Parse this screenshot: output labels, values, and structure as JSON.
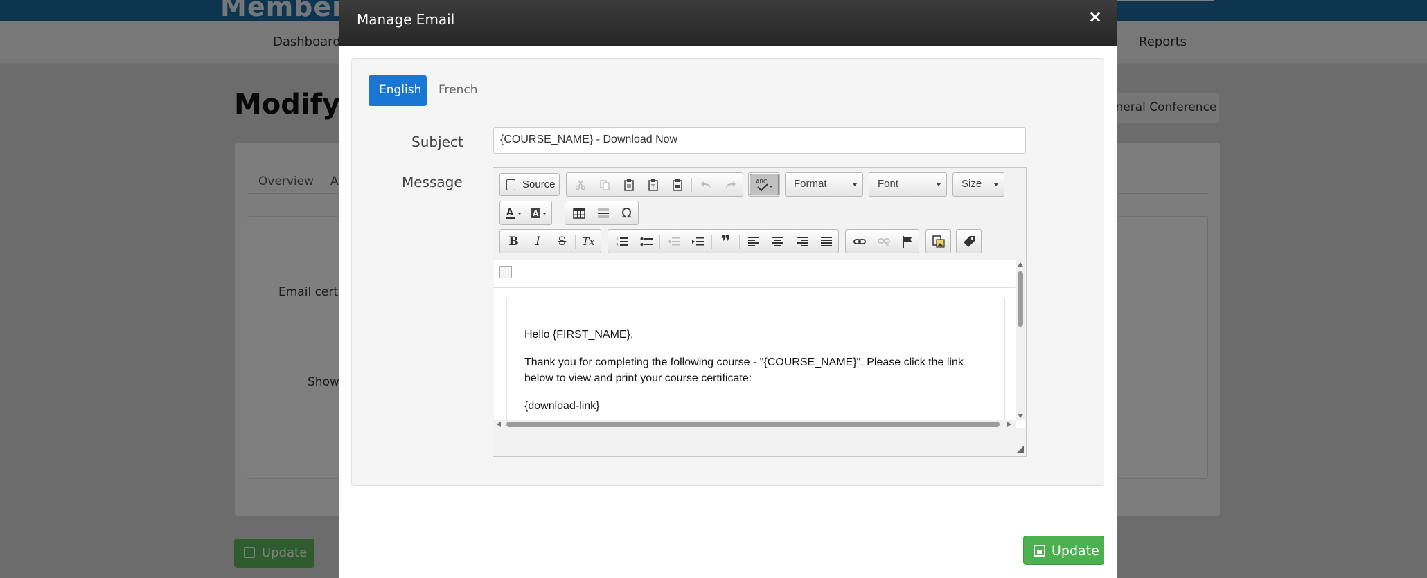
{
  "background": {
    "logo": "Member",
    "nav": [
      "Dashboard",
      "Reports"
    ],
    "page_title": "Modify L",
    "breadcrumb_button": "eneral Conference",
    "tabs": [
      "Overview",
      "A"
    ],
    "labels": [
      "Email certif",
      "Show"
    ],
    "update_label": "Update"
  },
  "modal": {
    "title": "Manage Email",
    "close_symbol": "×",
    "tabs": {
      "english": "English",
      "french": "French"
    },
    "subject_label": "Subject",
    "subject_value": "{COURSE_NAME} - Download Now",
    "message_label": "Message",
    "toolbar": {
      "source_label": "Source",
      "format_label": "Format",
      "font_label": "Font",
      "size_label": "Size",
      "omega_glyph": "Ω",
      "bold_glyph": "B",
      "italic_glyph": "I",
      "strike_glyph": "S",
      "clear_format_glyph": "Tx",
      "blockquote_glyph": "❞"
    },
    "email_body": {
      "greeting": "Hello {FIRST_NAME},",
      "line1": "Thank you for completing the following course - \"{COURSE_NAME}\". Please click the link",
      "line2": "below to view and print your course certificate:",
      "link_placeholder": "{download-link}"
    },
    "update_label": "Update"
  },
  "colors": {
    "primary_blue": "#1976d2",
    "success_green": "#4caf50",
    "header_dark": "#2e2e2e"
  }
}
